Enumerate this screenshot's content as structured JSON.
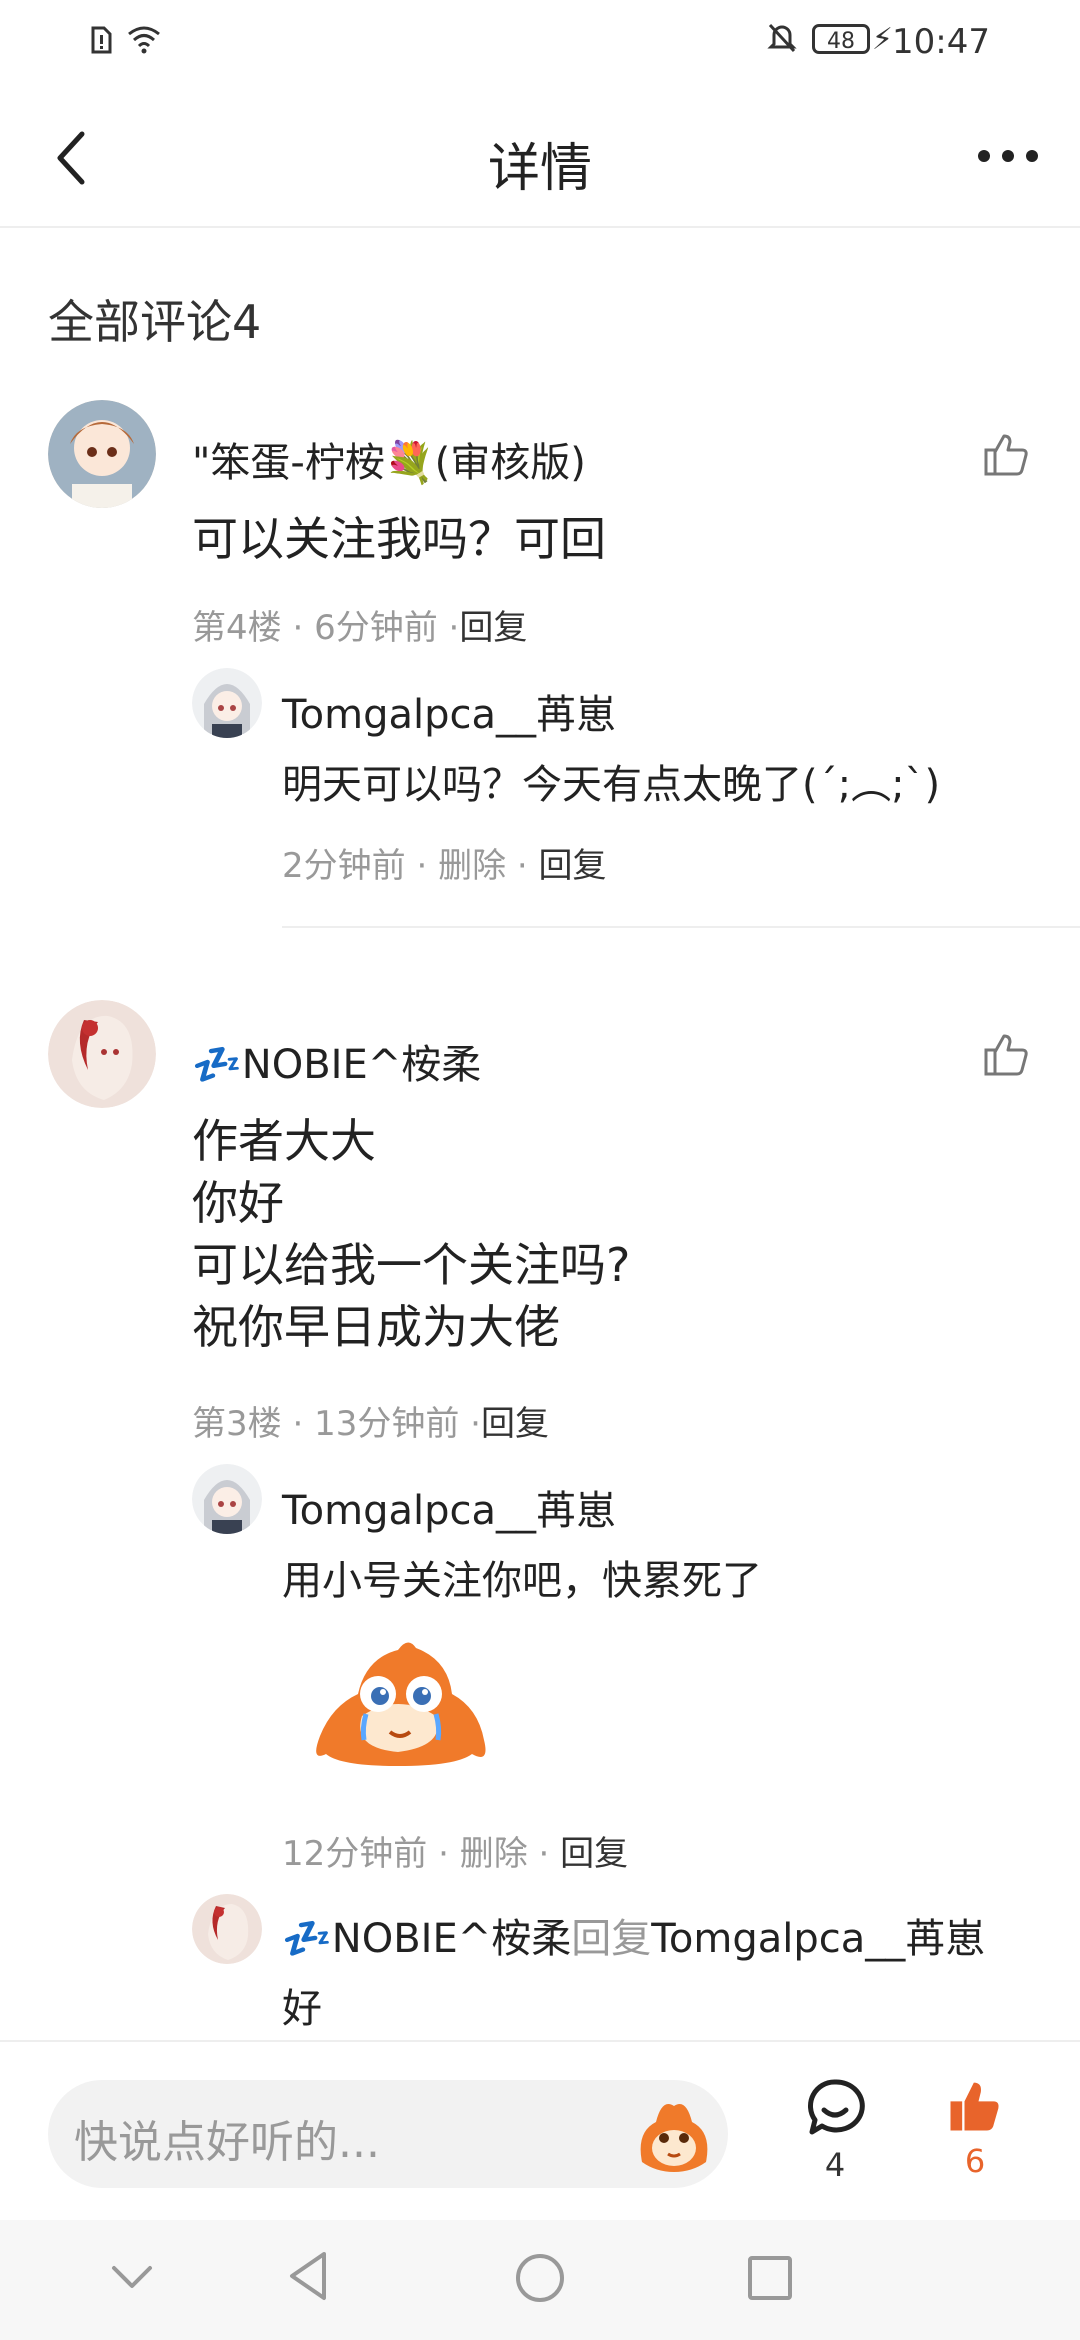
{
  "status_bar": {
    "time": "10:47",
    "battery": "48"
  },
  "header": {
    "title": "详情"
  },
  "section": {
    "title": "全部评论4"
  },
  "comments": [
    {
      "author": "\"笨蛋-柠桉💐(审核版)",
      "text_lines": [
        "可以关注我吗？可回"
      ],
      "floor": "第4楼",
      "time": "6分钟前",
      "reply_label": "回复",
      "replies": [
        {
          "author": "Tomgalpca__苒崽",
          "text": "明天可以吗？今天有点太晚了(´;︵;`)",
          "time": "2分钟前",
          "delete_label": "删除",
          "reply_label": "回复"
        }
      ]
    },
    {
      "author": "💤NOBIE^桉柔",
      "text_lines": [
        "作者大大",
        "你好",
        "可以给我一个关注吗?",
        "祝你早日成为大佬"
      ],
      "floor": "第3楼",
      "time": "13分钟前",
      "reply_label": "回复",
      "replies": [
        {
          "author": "Tomgalpca__苒崽",
          "text": "用小号关注你吧，快累死了",
          "sticker": "crying-fox-sticker",
          "time": "12分钟前",
          "delete_label": "删除",
          "reply_label": "回复"
        },
        {
          "author": "💤NOBIE^桉柔",
          "reply_word": "回复",
          "reply_to": "Tomgalpca__苒崽",
          "text": "好"
        }
      ]
    }
  ],
  "bottom_bar": {
    "placeholder": "快说点好听的...",
    "comment_count": "4",
    "like_count": "6"
  },
  "colors": {
    "accent": "#e8642b",
    "muted": "#999999",
    "divider": "#eeeeee"
  },
  "icons": [
    "back-arrow-icon",
    "more-dots-icon",
    "thumb-up-icon",
    "comment-bubble-icon",
    "emoji-icon"
  ]
}
